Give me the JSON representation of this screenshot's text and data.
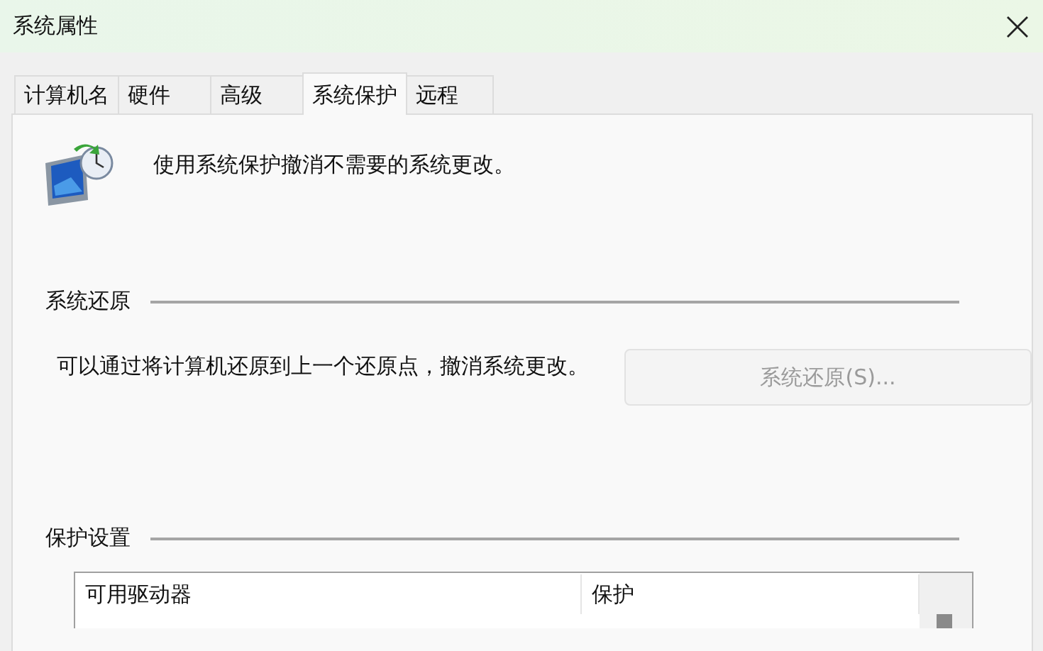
{
  "window": {
    "title": "系统属性"
  },
  "tabs": [
    {
      "label": "计算机名",
      "selected": false
    },
    {
      "label": "硬件",
      "selected": false
    },
    {
      "label": "高级",
      "selected": false
    },
    {
      "label": "系统保护",
      "selected": true
    },
    {
      "label": "远程",
      "selected": false
    }
  ],
  "intro": "使用系统保护撤消不需要的系统更改。",
  "restore": {
    "heading": "系统还原",
    "description": "可以通过将计算机还原到上一个还原点，撤消系统更改。",
    "button": {
      "label": "系统还原(S)...",
      "disabled": true
    }
  },
  "protection": {
    "heading": "保护设置",
    "table": {
      "columns": [
        "可用驱动器",
        "保护"
      ]
    }
  }
}
